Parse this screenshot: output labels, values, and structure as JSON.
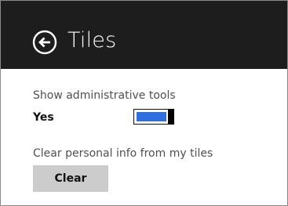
{
  "colors": {
    "header_background": "#1d1d1d",
    "header_text": "#ffffff",
    "toggle_fill": "#2f6fe0",
    "button_background": "#cccccc"
  },
  "header": {
    "back_icon": "arrow-left-circle-icon",
    "title": "Tiles"
  },
  "settings": {
    "admin_tools": {
      "label": "Show administrative tools",
      "state_text": "Yes",
      "on": true
    },
    "clear_info": {
      "label": "Clear personal info from my tiles",
      "button_label": "Clear"
    }
  }
}
